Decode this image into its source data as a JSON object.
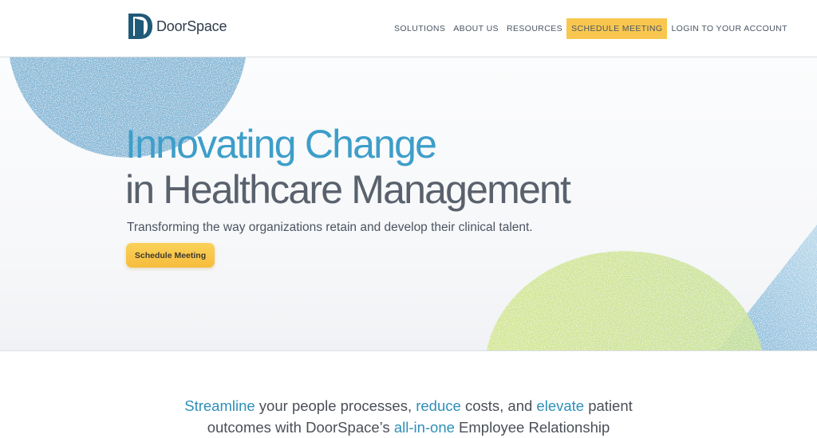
{
  "brand": {
    "name": "DoorSpace"
  },
  "nav": {
    "items": [
      {
        "label": "SOLUTIONS",
        "highlight": false
      },
      {
        "label": "ABOUT US",
        "highlight": false
      },
      {
        "label": "RESOURCES",
        "highlight": false
      },
      {
        "label": "SCHEDULE MEETING",
        "highlight": true
      },
      {
        "label": "LOGIN TO YOUR ACCOUNT",
        "highlight": false
      }
    ]
  },
  "hero": {
    "heading_line1": "Innovating Change",
    "heading_line2": "in Healthcare Management",
    "subtitle": "Transforming the way organizations retain and develop their clinical talent.",
    "cta_label": "Schedule Meeting"
  },
  "intro": {
    "word1": "Streamline",
    "text1": " your people processes, ",
    "word2": "reduce",
    "text2": " costs, and ",
    "word3": "elevate",
    "text3": " patient",
    "line2_text1": "outcomes with DoorSpace’s ",
    "line2_accent": "all-in-one",
    "line2_text2": " Employee Relationship"
  },
  "colors": {
    "accent_blue": "#3d9ec9",
    "heading_gray": "#59616d",
    "cta_yellow": "#f9c74f",
    "decor_green": "#c9e27a",
    "decor_blue": "#8cbfdc"
  }
}
